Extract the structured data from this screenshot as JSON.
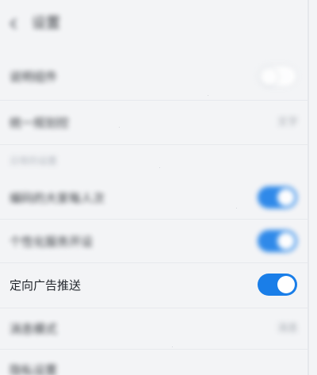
{
  "header": {
    "title": "设置"
  },
  "settings": {
    "row1": {
      "label": "说明组件",
      "state": "off"
    },
    "row2": {
      "label": "统一规划控",
      "value": "文字"
    },
    "section_label": "日常的设置",
    "row3": {
      "label": "编码的大家每人次",
      "state": "on"
    },
    "row4": {
      "label": "个性化服务开设",
      "state": "on"
    },
    "row5": {
      "label": "定向广告推送",
      "state": "on"
    },
    "row6": {
      "label": "消息模式",
      "value": "消息"
    },
    "row7": {
      "label": "隐私设置"
    }
  },
  "colors": {
    "accent": "#1a7ee8",
    "background": "#f3f4f6"
  }
}
